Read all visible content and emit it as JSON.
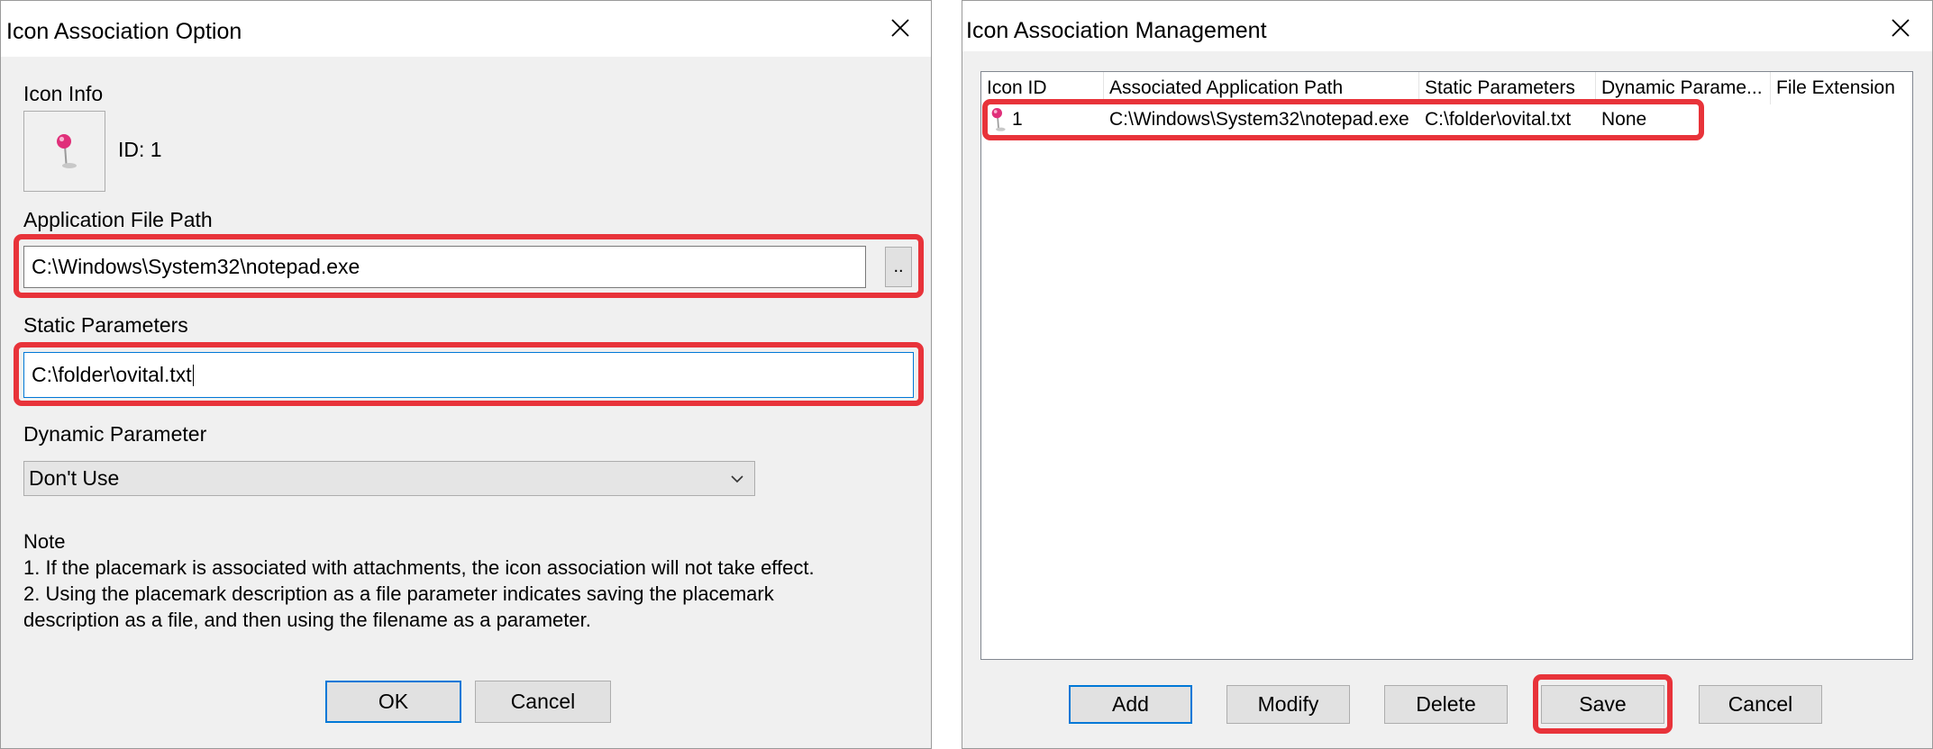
{
  "left_dialog": {
    "title": "Icon Association Option",
    "icon_info_label": "Icon Info",
    "icon": "pushpin-icon",
    "id_text": "ID: 1",
    "app_path_label": "Application File Path",
    "app_path_value": "C:\\Windows\\System32\\notepad.exe",
    "browse_label": "..",
    "static_params_label": "Static Parameters",
    "static_params_value": "C:\\folder\\ovital.txt",
    "dynamic_param_label": "Dynamic Parameter",
    "dynamic_param_selected": "Don't Use",
    "note_title": "Note",
    "note_line1": "1. If the placemark is associated with attachments, the icon association will not take effect.",
    "note_line2": "2. Using the placemark description as a file parameter indicates saving the placemark",
    "note_line3": "description as a file, and then using the filename as a parameter.",
    "ok_label": "OK",
    "cancel_label": "Cancel"
  },
  "right_dialog": {
    "title": "Icon Association Management",
    "columns": [
      "Icon ID",
      "Associated Application Path",
      "Static Parameters",
      "Dynamic Parame...",
      "File Extension"
    ],
    "rows": [
      {
        "icon": "pushpin-icon",
        "icon_id": "1",
        "app_path": "C:\\Windows\\System32\\notepad.exe",
        "static_params": "C:\\folder\\ovital.txt",
        "dynamic_param": "None",
        "file_extension": ""
      }
    ],
    "add_label": "Add",
    "modify_label": "Modify",
    "delete_label": "Delete",
    "save_label": "Save",
    "cancel_label": "Cancel"
  },
  "colors": {
    "highlight": "#e8333a",
    "focus_border": "#0078d7",
    "pin_head": "#e0307a",
    "dialog_bg": "#f0f0f0"
  }
}
